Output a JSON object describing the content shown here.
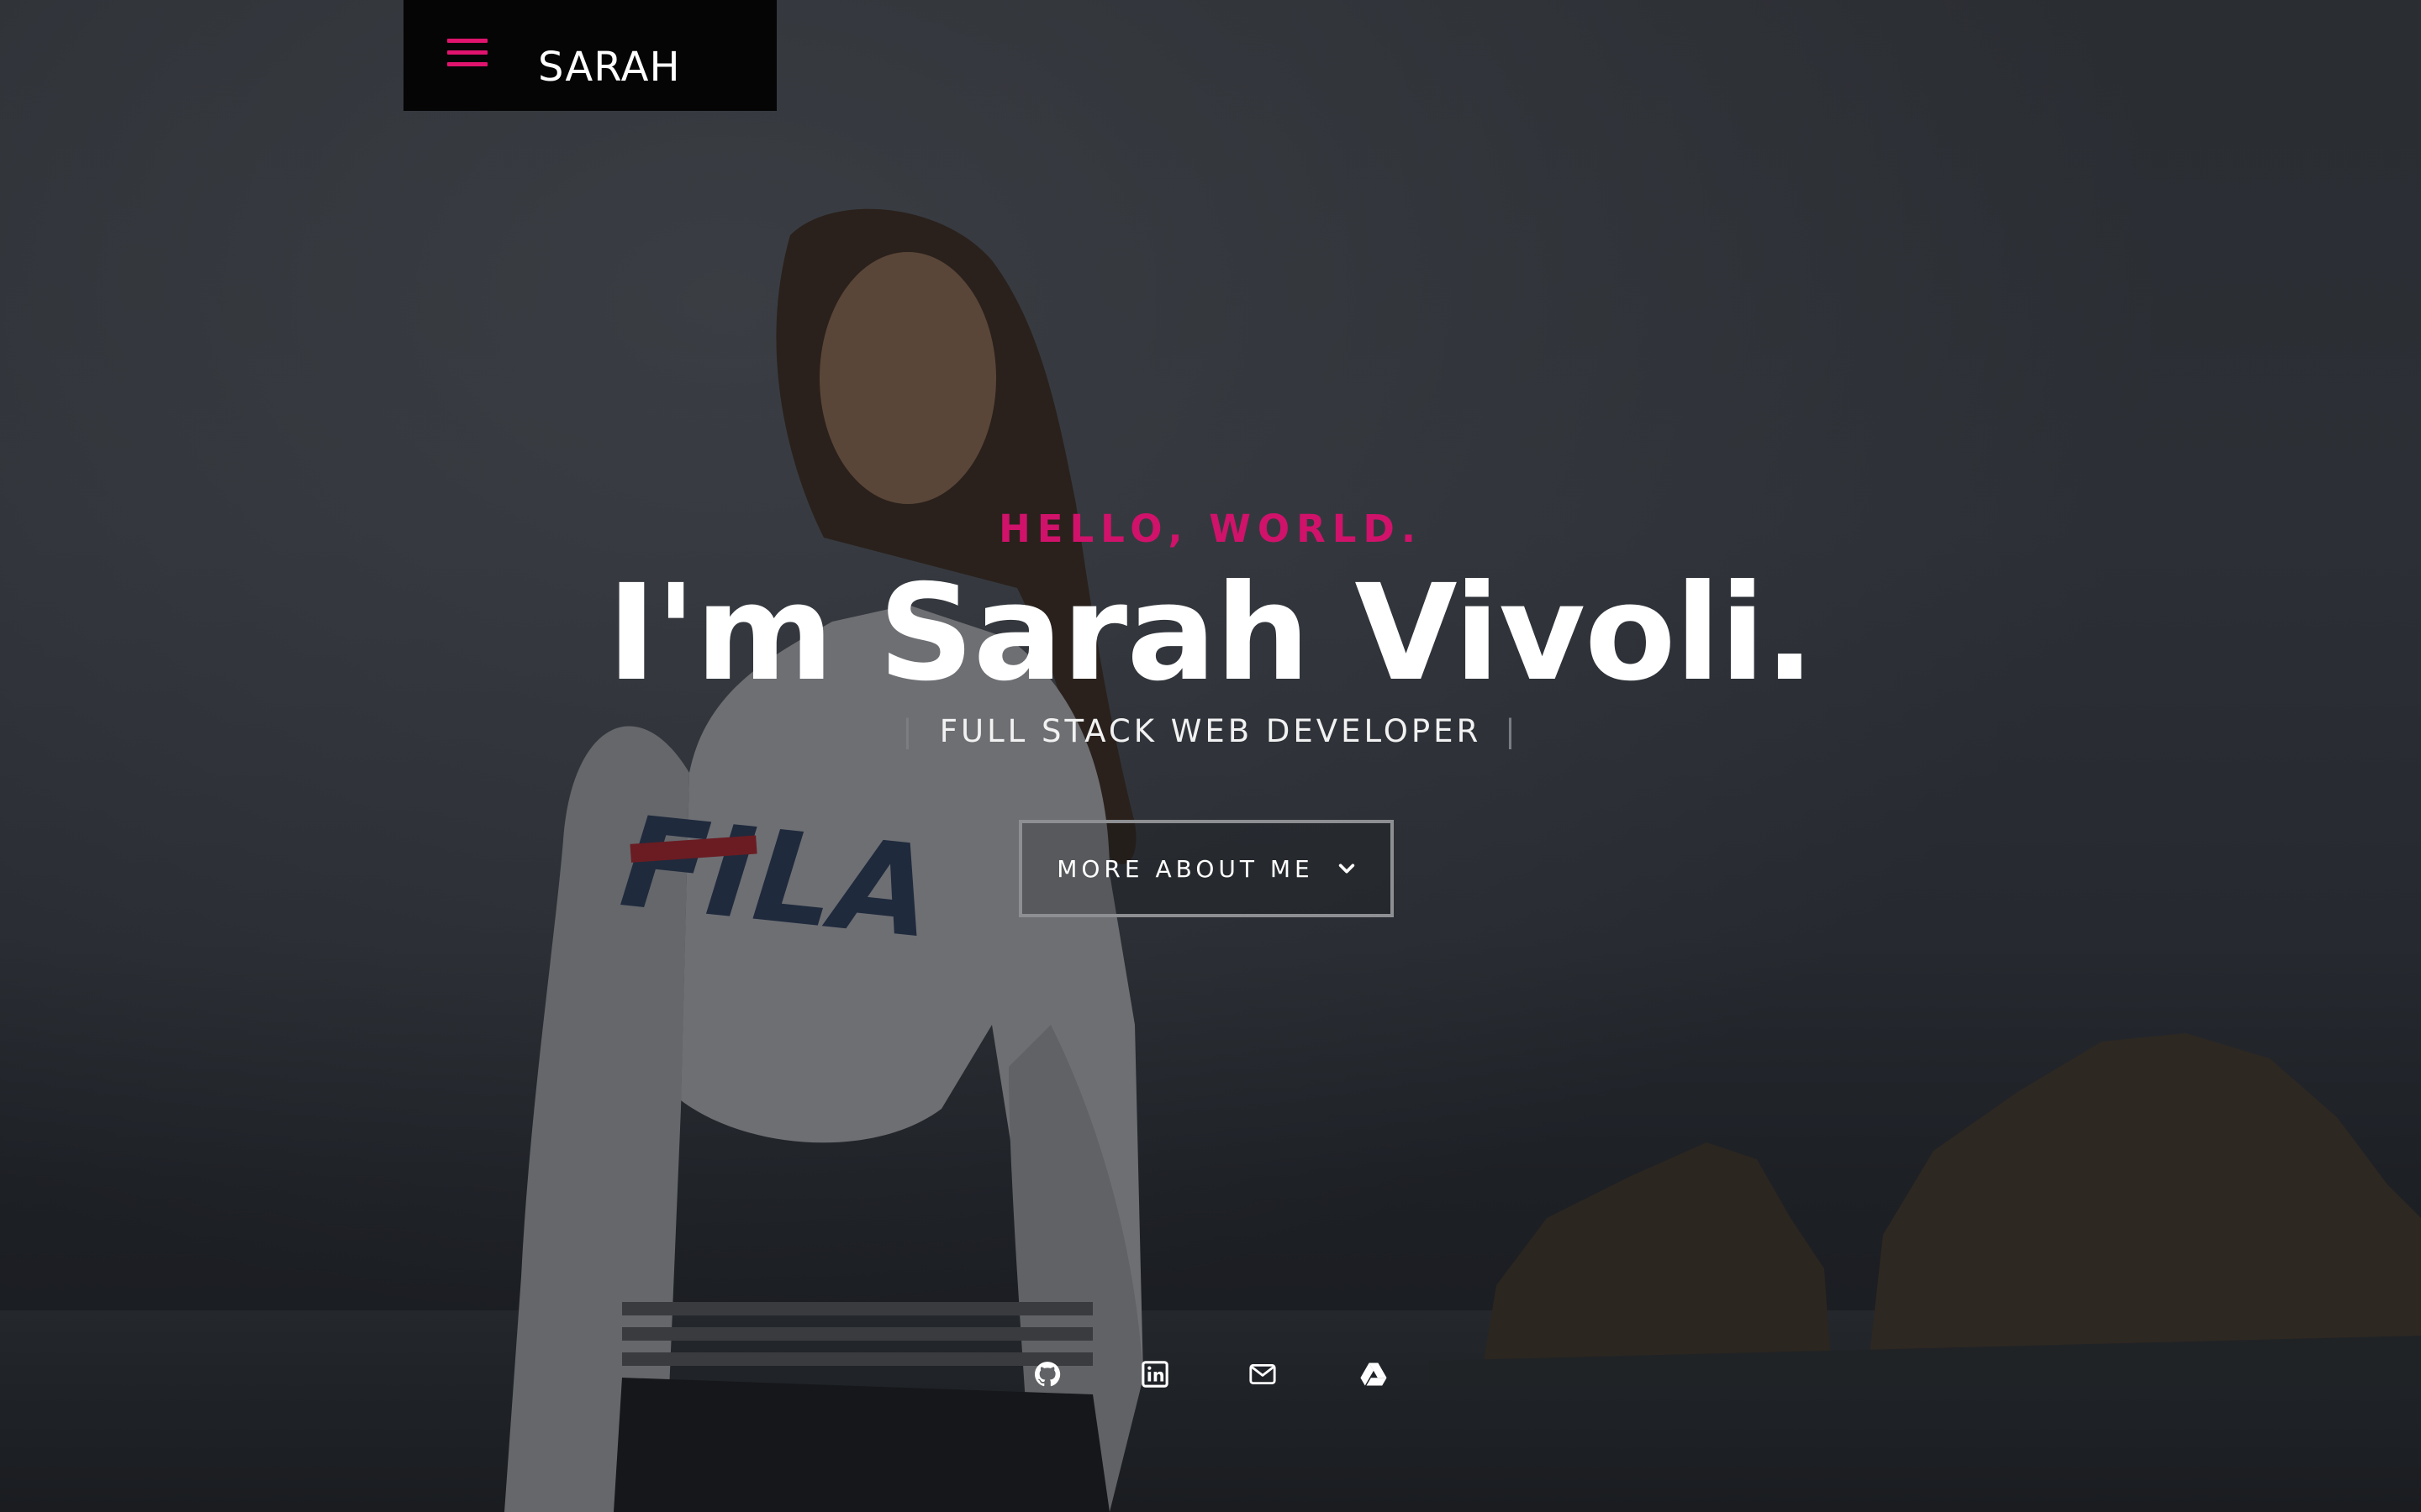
{
  "brand": {
    "name": "SARAH",
    "menu_icon": "hamburger-menu-icon",
    "accent_color": "#e0146e"
  },
  "hero": {
    "greeting": "HELLO, WORLD.",
    "heading": "I'm Sarah Vivoli.",
    "role": "FULL STACK WEB DEVELOPER",
    "separator": "|",
    "cta_label": "MORE ABOUT ME",
    "cta_icon": "chevron-down-icon"
  },
  "social": [
    {
      "icon": "github-icon"
    },
    {
      "icon": "linkedin-icon"
    },
    {
      "icon": "email-icon"
    },
    {
      "icon": "google-drive-icon"
    }
  ]
}
